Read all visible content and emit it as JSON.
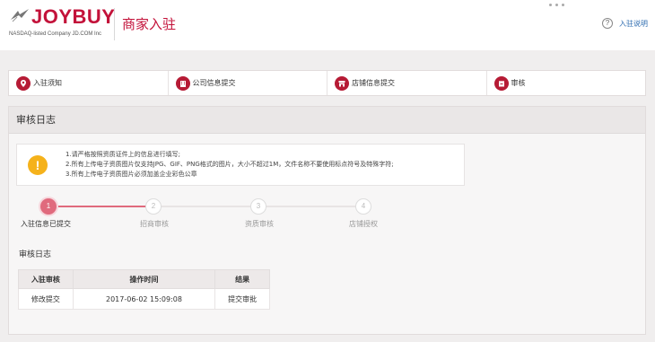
{
  "header": {
    "logo_text": "JOYBUY",
    "logo_subtitle": "NASDAQ-listed Company JD.COM Inc",
    "title": "商家入驻",
    "help_link": "入驻说明",
    "help_icon": "?"
  },
  "tabs": [
    {
      "label": "入驻须知",
      "icon": "map-pin-icon"
    },
    {
      "label": "公司信息提交",
      "icon": "building-icon"
    },
    {
      "label": "店铺信息提交",
      "icon": "store-icon"
    },
    {
      "label": "审核",
      "icon": "calendar-icon"
    }
  ],
  "main": {
    "title": "审核日志",
    "notice": {
      "icon": "!",
      "lines": [
        "1.请严格按照资质证件上的信息进行填写;",
        "2.所有上传电子资质图片仅支持JPG、GIF、PNG格式的图片，大小不超过1M，文件名称不要使用标点符号及特殊字符;",
        "3.所有上传电子资质图片必须加盖企业彩色公章"
      ]
    },
    "steps": [
      {
        "num": "1",
        "label": "入驻信息已提交",
        "active": true
      },
      {
        "num": "2",
        "label": "招商审核",
        "active": false
      },
      {
        "num": "3",
        "label": "资质审核",
        "active": false
      },
      {
        "num": "4",
        "label": "店铺授权",
        "active": false
      }
    ],
    "log_subtitle": "审核日志",
    "table": {
      "headers": [
        "入驻审核",
        "操作时间",
        "结果"
      ],
      "rows": [
        [
          "修改提交",
          "2017-06-02 15:09:08",
          "提交审批"
        ]
      ]
    }
  },
  "colors": {
    "brand": "#c3123a",
    "step_active": "#e06a7d",
    "warning": "#f5b21b"
  }
}
